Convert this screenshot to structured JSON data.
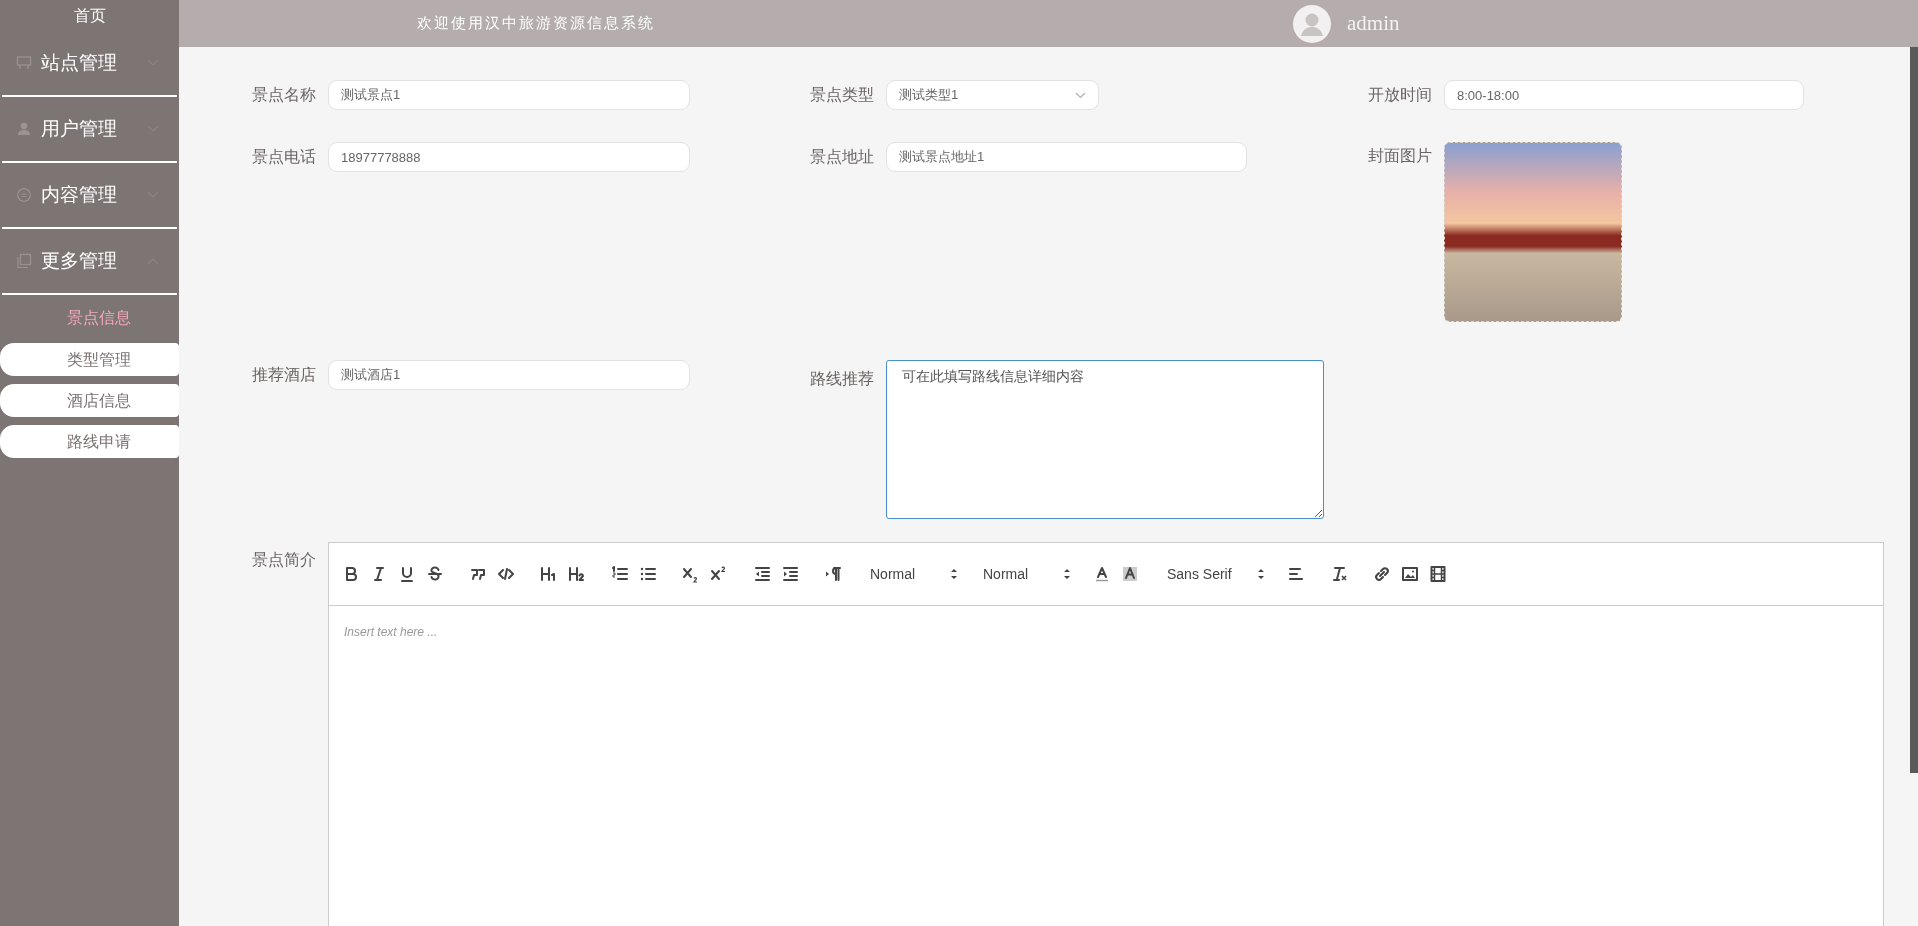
{
  "sidebar": {
    "home": "首页",
    "groups": [
      {
        "label": "站点管理",
        "expanded": false
      },
      {
        "label": "用户管理",
        "expanded": false
      },
      {
        "label": "内容管理",
        "expanded": false
      },
      {
        "label": "更多管理",
        "expanded": true,
        "children": [
          {
            "label": "景点信息",
            "selected": true
          },
          {
            "label": "类型管理",
            "selected": false
          },
          {
            "label": "酒店信息",
            "selected": false
          },
          {
            "label": "路线申请",
            "selected": false
          }
        ]
      }
    ]
  },
  "header": {
    "welcome": "欢迎使用汉中旅游资源信息系统",
    "user": "admin"
  },
  "form": {
    "rows": [
      [
        {
          "label": "景点名称",
          "kind": "input",
          "value": "测试景点1"
        },
        {
          "label": "景点类型",
          "kind": "select",
          "value": "测试类型1"
        },
        {
          "label": "开放时间",
          "kind": "input",
          "value": "8:00-18:00"
        }
      ],
      [
        {
          "label": "景点电话",
          "kind": "input",
          "value": "18977778888"
        },
        {
          "label": "景点地址",
          "kind": "input",
          "value": "测试景点地址1"
        },
        {
          "label": "封面图片",
          "kind": "image"
        }
      ],
      [
        {
          "label": "推荐酒店",
          "kind": "input",
          "value": "测试酒店1"
        },
        {
          "label": "路线推荐",
          "kind": "textarea",
          "placeholder": "可在此填写路线信息详细内容"
        }
      ]
    ],
    "editor": {
      "label": "景点简介",
      "pickers": [
        "Normal",
        "Normal",
        "Sans Serif"
      ],
      "placeholder": "Insert text here ..."
    }
  }
}
